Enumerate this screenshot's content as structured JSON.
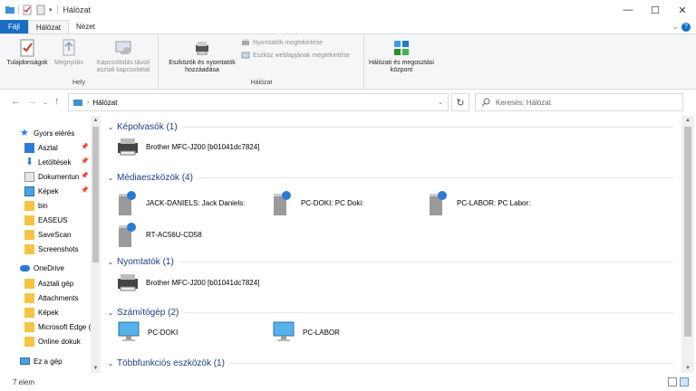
{
  "window": {
    "title": "Hálózat",
    "controls": {
      "minimize": "—",
      "maximize": "☐",
      "close": "✕"
    }
  },
  "ribbon_tabs": [
    {
      "label": "Fájl"
    },
    {
      "label": "Hálózat"
    },
    {
      "label": "Nézet"
    }
  ],
  "ribbon": {
    "properties": "Tulajdonságok",
    "open": "Megnyitás",
    "remote_desktop": "Kapcsolódás távoli asztali kapcsolattal",
    "group_hely": "Hely",
    "add_devices": "Eszközök és nyomtatók hozzáadása",
    "view_printers": "Nyomtatók megtekintése",
    "view_device_webpage": "Eszköz weblapjának megtekintése",
    "group_halozat": "Hálózat",
    "network_center": "Hálózati és megosztási központ"
  },
  "address": {
    "path": "Hálózat",
    "search_placeholder": "Keresés: Hálózat"
  },
  "sidebar": {
    "items": [
      {
        "label": "Gyors elérés"
      },
      {
        "label": "Asztal"
      },
      {
        "label": "Letöltések"
      },
      {
        "label": "Dokumentun"
      },
      {
        "label": "Képek"
      },
      {
        "label": "bin"
      },
      {
        "label": "EASEUS"
      },
      {
        "label": "SaveScan"
      },
      {
        "label": "Screenshots"
      },
      {
        "label": "OneDrive"
      },
      {
        "label": "Asztali gép"
      },
      {
        "label": "Attachments"
      },
      {
        "label": "Képek"
      },
      {
        "label": "Microsoft Edge ("
      },
      {
        "label": "Online dokuk"
      },
      {
        "label": "Ez a gép"
      }
    ]
  },
  "sections": [
    {
      "title": "Képolvasók (1)",
      "items": [
        "Brother MFC-J200 [b01041dc7824]"
      ]
    },
    {
      "title": "Médiaeszközök (4)",
      "items": [
        "JACK-DANIELS: Jack Daniels:",
        "PC-DOKI: PC Doki:",
        "PC-LABOR: PC Labor:",
        "RT-AC56U-CD58"
      ]
    },
    {
      "title": "Nyomtatók (1)",
      "items": [
        "Brother MFC-J200 [b01041dc7824]"
      ]
    },
    {
      "title": "Számítógép (2)",
      "items": [
        "PC-DOKI",
        "PC-LABOR"
      ]
    },
    {
      "title": "Többfunkciós eszközök (1)",
      "items": []
    }
  ],
  "status": {
    "count": "7 elem"
  }
}
